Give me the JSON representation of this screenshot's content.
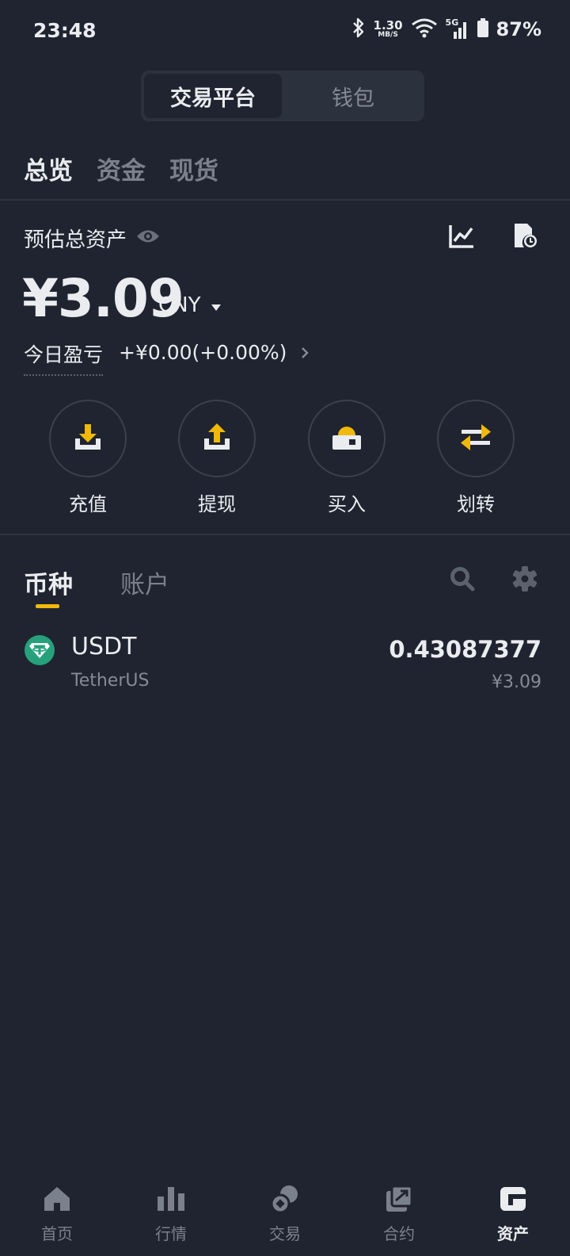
{
  "status_bar": {
    "time": "23:48",
    "net_speed_value": "1.30",
    "net_speed_unit": "MB/S",
    "network_type": "5G",
    "battery": "87%"
  },
  "segment": {
    "active": "交易平台",
    "inactive": "钱包"
  },
  "subtabs": [
    "总览",
    "资金",
    "现货"
  ],
  "overview": {
    "estimated_label": "预估总资产",
    "balance": "¥3.09",
    "currency": "CNY",
    "pnl_label": "今日盈亏",
    "pnl_value": "+¥0.00(+0.00%)"
  },
  "actions": [
    {
      "label": "充值",
      "icon": "deposit-icon"
    },
    {
      "label": "提现",
      "icon": "withdraw-icon"
    },
    {
      "label": "买入",
      "icon": "buy-icon"
    },
    {
      "label": "划转",
      "icon": "transfer-icon"
    }
  ],
  "asset_tabs": {
    "active": "币种",
    "inactive": "账户"
  },
  "coins": [
    {
      "symbol": "USDT",
      "name": "TetherUS",
      "amount": "0.43087377",
      "value": "¥3.09"
    }
  ],
  "bottom_nav": [
    {
      "label": "首页",
      "icon": "home-icon"
    },
    {
      "label": "行情",
      "icon": "markets-icon"
    },
    {
      "label": "交易",
      "icon": "trade-icon"
    },
    {
      "label": "合约",
      "icon": "futures-icon"
    },
    {
      "label": "资产",
      "icon": "wallet-icon"
    }
  ],
  "colors": {
    "background": "#1f2430",
    "accent": "#f0b90b",
    "tether": "#26a17b"
  }
}
